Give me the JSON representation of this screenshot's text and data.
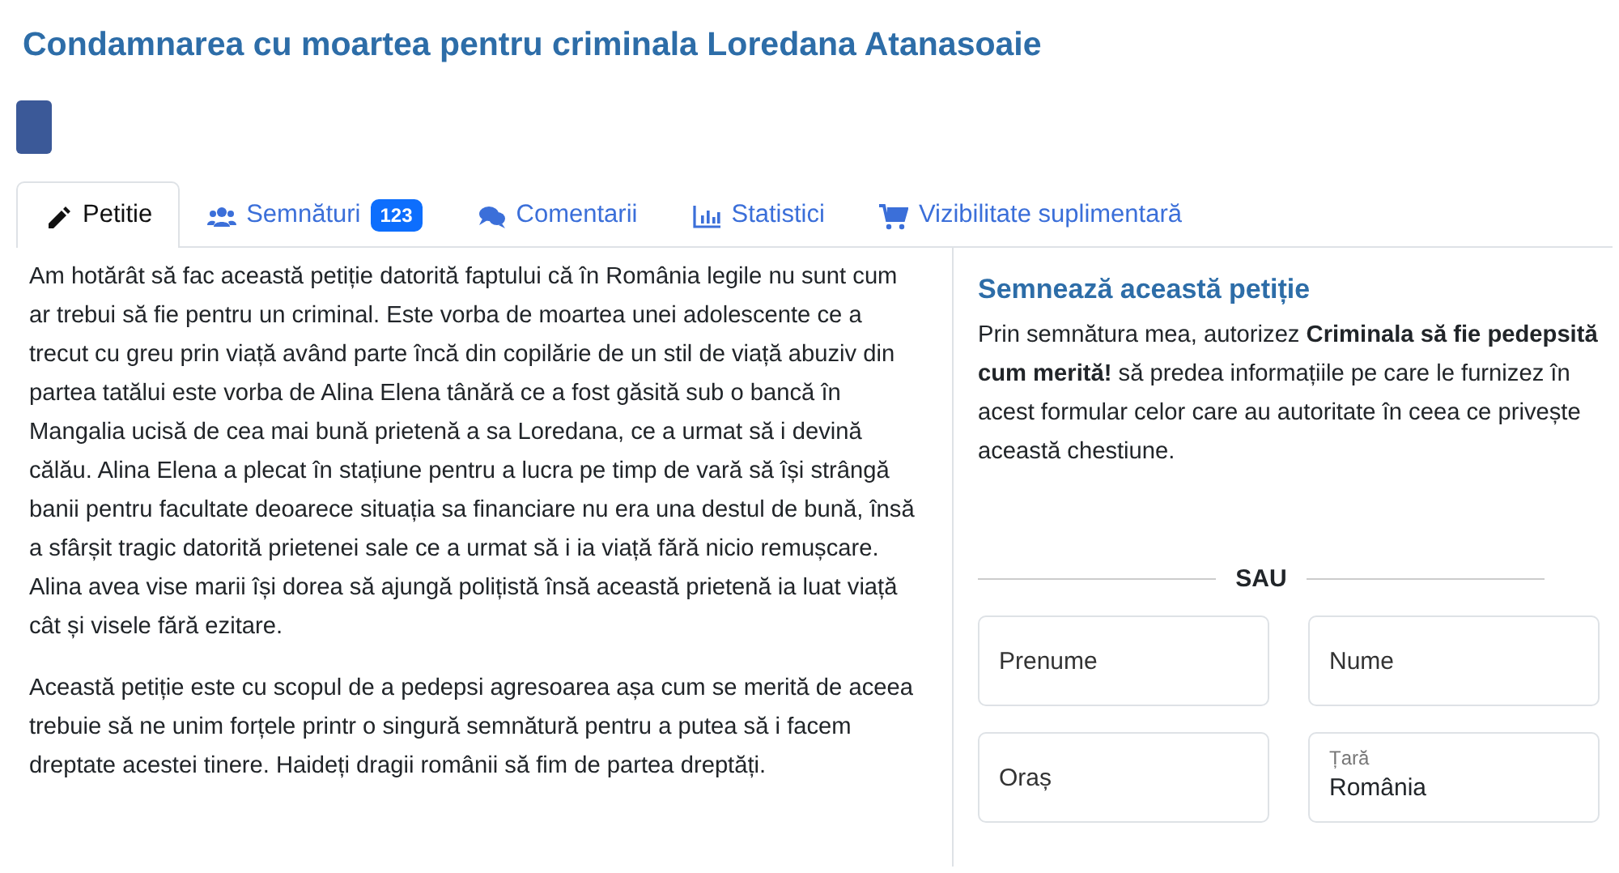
{
  "title": "Condamnarea cu moartea pentru criminala Loredana Atanasoaie",
  "tabs": [
    {
      "kind": "pencil",
      "label": "Petitie",
      "selected": true
    },
    {
      "kind": "users",
      "label": "Semnături",
      "badge": "123",
      "selected": false
    },
    {
      "kind": "comments",
      "label": "Comentarii",
      "selected": false
    },
    {
      "kind": "chart",
      "label": "Statistici",
      "selected": false
    },
    {
      "kind": "cart",
      "label": "Vizibilitate suplimentară",
      "selected": false
    }
  ],
  "petition_text": [
    "Am hotărât să fac această petiție datorită faptului că în România legile nu sunt cum ar trebui să fie pentru un criminal. Este vorba de moartea unei adolescente ce a trecut cu greu prin viață având parte încă din copilărie de un stil de viață abuziv din partea tatălui este vorba de Alina Elena tânără ce a fost găsită sub o bancă în Mangalia ucisă de cea mai bună prietenă a sa Loredana, ce a urmat să i devină călău. Alina Elena a plecat în stațiune pentru a lucra pe timp de vară să își strângă banii pentru facultate deoarece situația sa financiare nu era una destul de bună, însă a sfârșit tragic datorită prietenei sale ce a urmat să i ia viață fără nicio remușcare. Alina avea vise marii își dorea să ajungă polițistă însă această prietenă ia luat viață cât și visele fără ezitare.",
    "Această petiție este cu scopul de a pedepsi agresoarea așa cum se merită de aceea trebuie să ne unim forțele printr o singură semnătură pentru a putea să i facem dreptate acestei tinere. Haideți dragii românii să fim de partea dreptăți."
  ],
  "sign_panel": {
    "heading": "Semnează această petiție",
    "consent": "Prin semnătura mea, autorizez **Criminala să fie pedepsită cum merită!** să predea informațiile pe care le furnizez în acest formular celor care au autoritate în ceea ce privește această chestiune.",
    "divider_label": "SAU",
    "field_rows": [
      {
        "fields": [
          {
            "placeholder": "Prenume"
          },
          {
            "placeholder": "Nume"
          }
        ]
      },
      {
        "fields": [
          {
            "placeholder": "Oraș"
          },
          {
            "label": "Țară",
            "value": "România"
          }
        ]
      }
    ]
  }
}
